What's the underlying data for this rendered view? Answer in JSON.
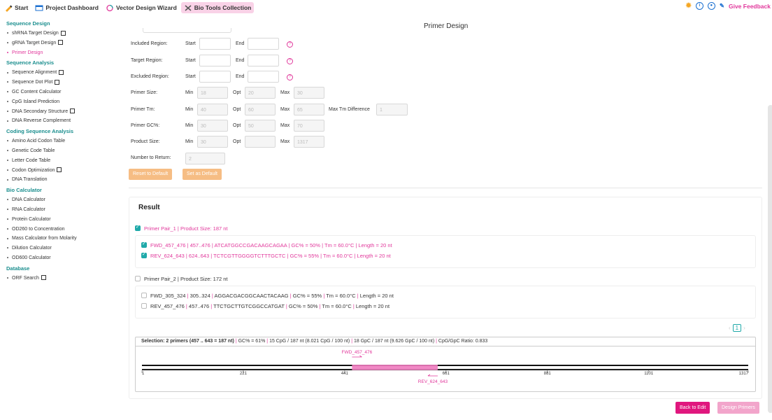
{
  "tabs": [
    {
      "label": "Start",
      "icon": "pen-icon"
    },
    {
      "label": "Project Dashboard",
      "icon": "dashboard-icon"
    },
    {
      "label": "Vector Design Wizard",
      "icon": "plasmid-icon"
    },
    {
      "label": "Bio Tools Collection",
      "icon": "tools-icon",
      "active": true
    }
  ],
  "header_right": {
    "feedback": "Give Feedback"
  },
  "sidebar": {
    "sections": [
      {
        "title": "Sequence Design",
        "items": [
          {
            "label": "shRNA Target Design",
            "ext": true
          },
          {
            "label": "gRNA Target Design",
            "ext": true
          },
          {
            "label": "Primer Design",
            "active": true
          }
        ]
      },
      {
        "title": "Sequence Analysis",
        "items": [
          {
            "label": "Sequence Alignment",
            "ext": true
          },
          {
            "label": "Sequence Dot Plot",
            "ext": true
          },
          {
            "label": "GC Content Calculator"
          },
          {
            "label": "CpG Island Prediction"
          },
          {
            "label": "DNA Secondary Structure",
            "ext": true
          },
          {
            "label": "DNA Reverse Complement"
          }
        ]
      },
      {
        "title": "Coding Sequence Analysis",
        "items": [
          {
            "label": "Amino Acid Codon Table"
          },
          {
            "label": "Genetic Code Table"
          },
          {
            "label": "Letter Code Table"
          },
          {
            "label": "Codon Optimization",
            "ext": true
          },
          {
            "label": "DNA Translation"
          }
        ]
      },
      {
        "title": "Bio Calculator",
        "items": [
          {
            "label": "DNA Calculator"
          },
          {
            "label": "RNA Calculator"
          },
          {
            "label": "Protein Calculator"
          },
          {
            "label": "OD260 to Concentration"
          },
          {
            "label": "Mass Calculator from Molarity"
          },
          {
            "label": "Dilution Calculator"
          },
          {
            "label": "OD600 Calculator"
          }
        ]
      },
      {
        "title": "Database",
        "items": [
          {
            "label": "ORF Search",
            "ext": true
          }
        ]
      }
    ]
  },
  "page_title": "Primer Design",
  "form": {
    "included_region": "Included Region:",
    "target_region": "Target Region:",
    "excluded_region": "Excluded Region:",
    "start": "Start",
    "end": "End",
    "min": "Min",
    "opt": "Opt",
    "max": "Max",
    "primer_size": {
      "label": "Primer Size:",
      "min": "18",
      "opt": "20",
      "max": "30"
    },
    "primer_tm": {
      "label": "Primer Tm:",
      "min": "40",
      "opt": "60",
      "max": "65"
    },
    "max_tm_diff": {
      "label": "Max Tm Difference",
      "value": "1"
    },
    "primer_gc": {
      "label": "Primer GC%:",
      "min": "30",
      "opt": "50",
      "max": "70"
    },
    "product_size": {
      "label": "Product Size:",
      "min": "30",
      "opt": "",
      "max": "1317"
    },
    "number_return": {
      "label": "Number to Return:",
      "value": "2"
    },
    "reset_btn": "Reset to Default",
    "set_default_btn": "Set as Default"
  },
  "result": {
    "title": "Result",
    "pair1": {
      "header": "Primer Pair_1 | Product Size: 187 nt",
      "fwd": [
        "FWD_457_476",
        "457..476",
        "ATCATGGCCGACAAGCAGAA",
        "GC% = 50%",
        "Tm = 60.0°C",
        "Length = 20 nt"
      ],
      "rev": [
        "REV_624_643",
        "624..643",
        "TCTCGTTGGGGTCTTTGCTC",
        "GC% = 55%",
        "Tm = 60.0°C",
        "Length = 20 nt"
      ]
    },
    "pair2": {
      "header": "Primer Pair_2 | Product Size: 172 nt",
      "fwd": [
        "FWD_305_324",
        "305..324",
        "AGGACGACGGCAACTACAAG",
        "GC% = 55%",
        "Tm = 60.0°C",
        "Length = 20 nt"
      ],
      "rev": [
        "REV_457_476",
        "457..476",
        "TTCTGCTTGTCGGCCATGAT",
        "GC% = 50%",
        "Tm = 60.0°C",
        "Length = 20 nt"
      ]
    },
    "page": "1",
    "selection": {
      "label": "Selection: 2 primers (457 .. 643 = 187 nt)",
      "gc": "GC% = 61%",
      "cpg": "15 CpG / 187 nt (8.021 CpG / 100 nt)",
      "gpc": "18 GpC / 187 nt (9.626 GpC / 100 nt)",
      "ratio": "CpG/GpC Ratio: 0.833"
    },
    "map": {
      "length": 1317,
      "selection": [
        457,
        643
      ],
      "ticks": [
        "1",
        "221",
        "441",
        "661",
        "881",
        "1101",
        "1317"
      ],
      "fwd_label": "FWD_457_476",
      "rev_label": "REV_624_643"
    }
  },
  "buttons": {
    "back": "Back to Edit",
    "design": "Design Primers"
  },
  "colors": {
    "accent": "#e1379b",
    "teal": "#1fa9a9",
    "orange": "#f6bd84"
  }
}
